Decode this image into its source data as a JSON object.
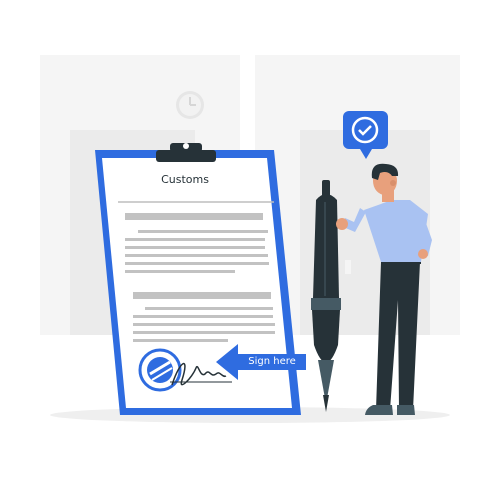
{
  "document": {
    "title": "Customs",
    "callout_label": "Sign here"
  },
  "colors": {
    "accent": "#2f6ce0",
    "dark": "#263238",
    "shirt": "#a9c2f2",
    "background_shape": "#ebebeb"
  },
  "icons": {
    "bubble": "check-badge-icon",
    "arrow": "arrow-left-icon",
    "clock": "clock-icon",
    "stamp": "stamp-icon"
  }
}
